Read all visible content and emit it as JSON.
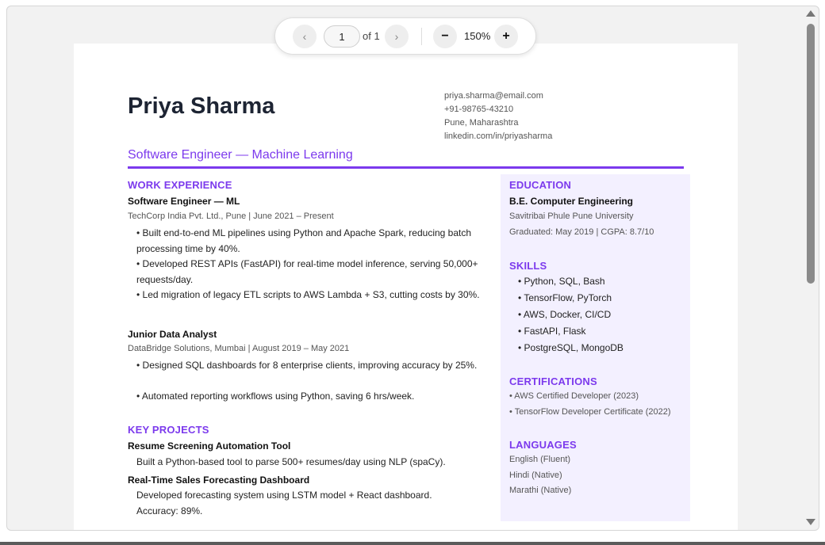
{
  "toolbar": {
    "prev_icon": "‹",
    "next_icon": "›",
    "current_page": "1",
    "page_count": "of 1",
    "zoom_out_icon": "−",
    "zoom_level": "150%",
    "zoom_in_icon": "+"
  },
  "resume": {
    "name": "Priya Sharma",
    "contact": {
      "email": "priya.sharma@email.com",
      "phone": "+91-98765-43210",
      "location": "Pune, Maharashtra",
      "linkedin": "linkedin.com/in/priyasharma"
    },
    "headline": "Software Engineer — Machine Learning",
    "work": {
      "title": "WORK EXPERIENCE",
      "jobs": [
        {
          "role": "Software Engineer — ML",
          "meta": "TechCorp India Pvt. Ltd., Pune | June 2021 – Present",
          "bullets": [
            "• Built end-to-end ML pipelines using Python and Apache Spark, reducing batch processing time by 40%.",
            "• Developed REST APIs (FastAPI) for real-time model inference, serving 50,000+ requests/day.",
            "• Led migration of legacy ETL scripts to AWS Lambda + S3, cutting costs by 30%."
          ]
        },
        {
          "role": "Junior Data Analyst",
          "meta": "DataBridge Solutions, Mumbai | August 2019 – May 2021",
          "bullets": [
            "• Designed SQL dashboards for 8 enterprise clients, improving accuracy by 25%.",
            "• Automated reporting workflows using Python, saving 6 hrs/week."
          ]
        }
      ]
    },
    "projects": {
      "title": "KEY PROJECTS",
      "items": [
        {
          "name": "Resume Screening Automation Tool",
          "desc": "Built a Python-based tool to parse 500+ resumes/day using NLP (spaCy)."
        },
        {
          "name": "Real-Time Sales Forecasting Dashboard",
          "desc": "Developed forecasting system using LSTM model + React dashboard. Accuracy: 89%."
        }
      ]
    },
    "education": {
      "title": "EDUCATION",
      "degree": "B.E. Computer Engineering",
      "school": "Savitribai Phule Pune University",
      "details": "Graduated: May 2019 | CGPA: 8.7/10"
    },
    "skills": {
      "title": "SKILLS",
      "items": [
        "• Python, SQL, Bash",
        "• TensorFlow, PyTorch",
        "• AWS, Docker, CI/CD",
        "• FastAPI, Flask",
        "• PostgreSQL, MongoDB"
      ]
    },
    "certifications": {
      "title": "CERTIFICATIONS",
      "items": [
        "• AWS Certified Developer (2023)",
        "• TensorFlow Developer Certificate (2022)"
      ]
    },
    "languages": {
      "title": "LANGUAGES",
      "items": [
        "English (Fluent)",
        "Hindi (Native)",
        "Marathi (Native)"
      ]
    }
  },
  "colors": {
    "accent": "#7c3aed",
    "sidebar_bg": "#f3f0ff",
    "heading_text": "#1d2433"
  },
  "icons": [
    "chevron-left-icon",
    "chevron-right-icon",
    "minus-icon",
    "plus-icon",
    "scroll-up-arrow-icon",
    "scroll-down-arrow-icon"
  ]
}
